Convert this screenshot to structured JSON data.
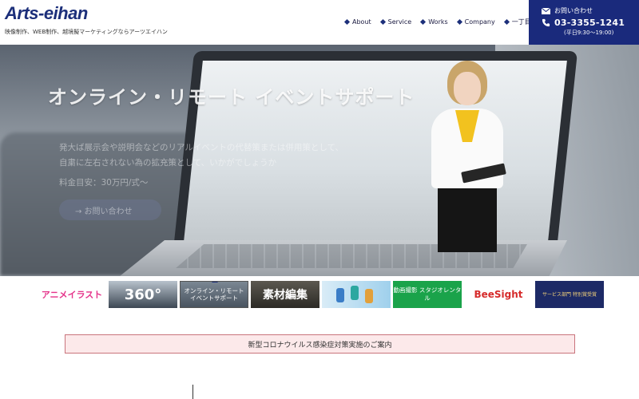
{
  "header": {
    "logo": "Arts-eihan",
    "tagline": "映像制作、WEB制作、越境擬マーケティングならアーツエイハン",
    "nav": [
      {
        "label": "About"
      },
      {
        "label": "Service"
      },
      {
        "label": "Works"
      },
      {
        "label": "Company"
      },
      {
        "label": "一丁目通信"
      }
    ],
    "contact": {
      "label": "お問い合わせ",
      "phone": "03-3355-1241",
      "hours": "(平日9:30〜19:00)"
    }
  },
  "hero": {
    "title": "オンライン・リモート イベントサポート",
    "description": "発大ば展示会や説明会などのリアルイベントの代替策または併用策として、\n自粛に左右されない為の拡充策として、いかがでしょうか",
    "price": "料金目安：30万円/式〜",
    "button_label": "→ お問い合わせ"
  },
  "banners": [
    {
      "label": "アニメイラスト"
    },
    {
      "label": "360°"
    },
    {
      "label": "オンライン・リモート イベントサポート"
    },
    {
      "label": "素材編集"
    },
    {
      "label": ""
    },
    {
      "label": "動画撮影 スタジオレンタル"
    },
    {
      "label": "BeeSight"
    },
    {
      "label": "サービス部門 特別賞受賞"
    }
  ],
  "notice": {
    "label": "新型コロナウイルス感染症対策実施のご案内"
  },
  "colors": {
    "brand_navy": "#1c2f7a",
    "contact_bg": "#1a2a7c",
    "notice_bg": "#fce9ea",
    "notice_border": "#c9747c"
  }
}
